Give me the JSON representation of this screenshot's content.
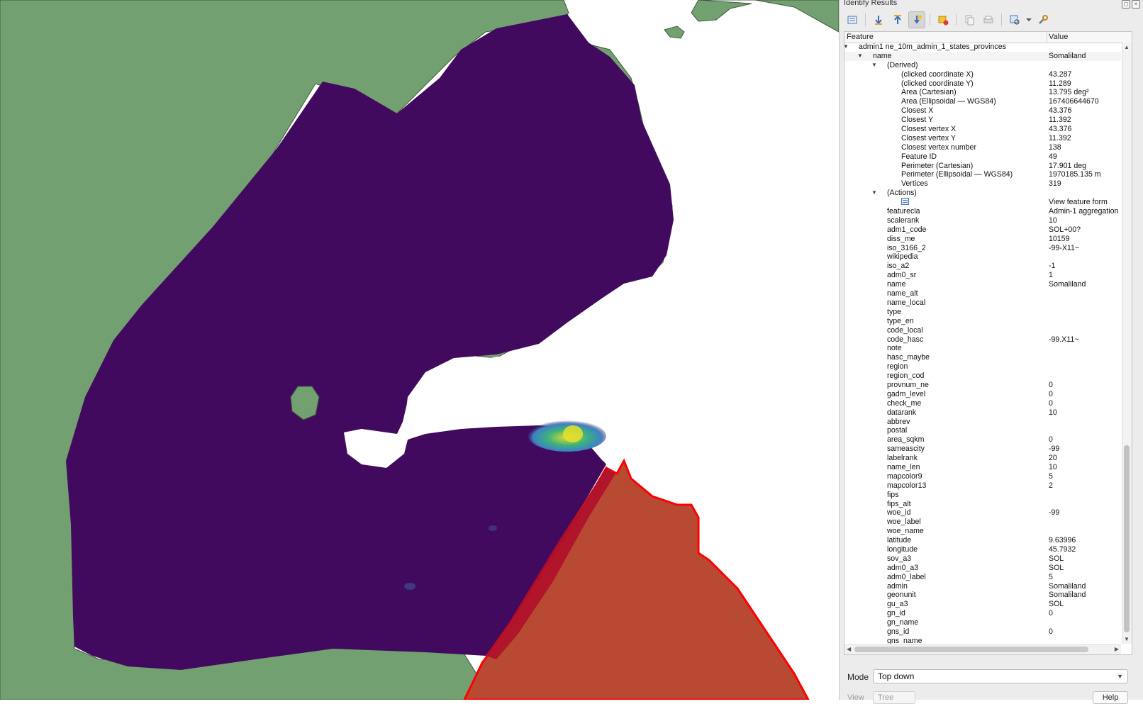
{
  "colors": {
    "land": "#73a070",
    "land_outline": "#3e5a3c",
    "raster_dark": "#420a5e",
    "raster_hot_yellow": "#e6e02a",
    "raster_hot_green": "#3fb27a",
    "raster_hot_blue": "#3b82c4",
    "selected_fill": "#b84a33",
    "selected_outline": "#ff0000",
    "sea": "#ffffff"
  },
  "panel": {
    "title": "Identify Results",
    "toolbar_icons": [
      {
        "name": "expand-tree-icon",
        "active": false
      },
      {
        "name": "expand-all-icon",
        "active": false
      },
      {
        "name": "collapse-all-icon",
        "active": false
      },
      {
        "name": "expand-new-results-icon",
        "active": true
      },
      {
        "name": "clear-results-icon",
        "active": false
      },
      {
        "name": "copy-feature-icon",
        "active": false
      },
      {
        "name": "print-icon",
        "active": false
      },
      {
        "name": "select-features-icon",
        "active": false
      },
      {
        "name": "settings-icon",
        "active": false
      }
    ],
    "columns": {
      "feature": "Feature",
      "value": "Value"
    },
    "rows": [
      {
        "level": 0,
        "arrow": "down",
        "key": "admin1 ne_10m_admin_1_states_provinces",
        "value": ""
      },
      {
        "level": 1,
        "arrow": "down",
        "key": "name",
        "value": "Somaliland",
        "highlight": true
      },
      {
        "level": 2,
        "arrow": "down",
        "key": "(Derived)",
        "value": ""
      },
      {
        "level": 3,
        "key": "(clicked coordinate X)",
        "value": "43.287"
      },
      {
        "level": 3,
        "key": "(clicked coordinate Y)",
        "value": "11.289"
      },
      {
        "level": 3,
        "key": "Area (Cartesian)",
        "value": "13.795 deg²"
      },
      {
        "level": 3,
        "key": "Area (Ellipsoidal — WGS84)",
        "value": "167406644670"
      },
      {
        "level": 3,
        "key": "Closest X",
        "value": "43.376"
      },
      {
        "level": 3,
        "key": "Closest Y",
        "value": "11.392"
      },
      {
        "level": 3,
        "key": "Closest vertex X",
        "value": "43.376"
      },
      {
        "level": 3,
        "key": "Closest vertex Y",
        "value": "11.392"
      },
      {
        "level": 3,
        "key": "Closest vertex number",
        "value": "138"
      },
      {
        "level": 3,
        "key": "Feature ID",
        "value": "49"
      },
      {
        "level": 3,
        "key": "Perimeter (Cartesian)",
        "value": "17.901 deg"
      },
      {
        "level": 3,
        "key": "Perimeter (Ellipsoidal — WGS84)",
        "value": "1970185.135 m"
      },
      {
        "level": 3,
        "key": "Vertices",
        "value": "319"
      },
      {
        "level": 2,
        "arrow": "down",
        "key": "(Actions)",
        "value": ""
      },
      {
        "level": 3,
        "icon": "form-icon",
        "key": "",
        "value": "View feature form"
      },
      {
        "level": 2,
        "key": "featurecla",
        "value": "Admin-1 aggregation"
      },
      {
        "level": 2,
        "key": "scalerank",
        "value": "10"
      },
      {
        "level": 2,
        "key": "adm1_code",
        "value": "SOL+00?"
      },
      {
        "level": 2,
        "key": "diss_me",
        "value": "10159"
      },
      {
        "level": 2,
        "key": "iso_3166_2",
        "value": "-99-X11~"
      },
      {
        "level": 2,
        "key": "wikipedia",
        "value": ""
      },
      {
        "level": 2,
        "key": "iso_a2",
        "value": "-1"
      },
      {
        "level": 2,
        "key": "adm0_sr",
        "value": "1"
      },
      {
        "level": 2,
        "key": "name",
        "value": "Somaliland"
      },
      {
        "level": 2,
        "key": "name_alt",
        "value": ""
      },
      {
        "level": 2,
        "key": "name_local",
        "value": ""
      },
      {
        "level": 2,
        "key": "type",
        "value": ""
      },
      {
        "level": 2,
        "key": "type_en",
        "value": ""
      },
      {
        "level": 2,
        "key": "code_local",
        "value": ""
      },
      {
        "level": 2,
        "key": "code_hasc",
        "value": "-99.X11~"
      },
      {
        "level": 2,
        "key": "note",
        "value": ""
      },
      {
        "level": 2,
        "key": "hasc_maybe",
        "value": ""
      },
      {
        "level": 2,
        "key": "region",
        "value": ""
      },
      {
        "level": 2,
        "key": "region_cod",
        "value": ""
      },
      {
        "level": 2,
        "key": "provnum_ne",
        "value": "0"
      },
      {
        "level": 2,
        "key": "gadm_level",
        "value": "0"
      },
      {
        "level": 2,
        "key": "check_me",
        "value": "0"
      },
      {
        "level": 2,
        "key": "datarank",
        "value": "10"
      },
      {
        "level": 2,
        "key": "abbrev",
        "value": ""
      },
      {
        "level": 2,
        "key": "postal",
        "value": ""
      },
      {
        "level": 2,
        "key": "area_sqkm",
        "value": "0"
      },
      {
        "level": 2,
        "key": "sameascity",
        "value": "-99"
      },
      {
        "level": 2,
        "key": "labelrank",
        "value": "20"
      },
      {
        "level": 2,
        "key": "name_len",
        "value": "10"
      },
      {
        "level": 2,
        "key": "mapcolor9",
        "value": "5"
      },
      {
        "level": 2,
        "key": "mapcolor13",
        "value": "2"
      },
      {
        "level": 2,
        "key": "fips",
        "value": ""
      },
      {
        "level": 2,
        "key": "fips_alt",
        "value": ""
      },
      {
        "level": 2,
        "key": "woe_id",
        "value": "-99"
      },
      {
        "level": 2,
        "key": "woe_label",
        "value": ""
      },
      {
        "level": 2,
        "key": "woe_name",
        "value": ""
      },
      {
        "level": 2,
        "key": "latitude",
        "value": "9.63996"
      },
      {
        "level": 2,
        "key": "longitude",
        "value": "45.7932"
      },
      {
        "level": 2,
        "key": "sov_a3",
        "value": "SOL"
      },
      {
        "level": 2,
        "key": "adm0_a3",
        "value": "SOL"
      },
      {
        "level": 2,
        "key": "adm0_label",
        "value": "5"
      },
      {
        "level": 2,
        "key": "admin",
        "value": "Somaliland"
      },
      {
        "level": 2,
        "key": "geonunit",
        "value": "Somaliland"
      },
      {
        "level": 2,
        "key": "gu_a3",
        "value": "SOL"
      },
      {
        "level": 2,
        "key": "gn_id",
        "value": "0"
      },
      {
        "level": 2,
        "key": "gn_name",
        "value": ""
      },
      {
        "level": 2,
        "key": "gns_id",
        "value": "0"
      },
      {
        "level": 2,
        "key": "gns_name",
        "value": ""
      }
    ],
    "mode": {
      "label": "Mode",
      "value": "Top down"
    },
    "view": {
      "label": "View",
      "value": "Tree"
    },
    "help_label": "Help"
  }
}
